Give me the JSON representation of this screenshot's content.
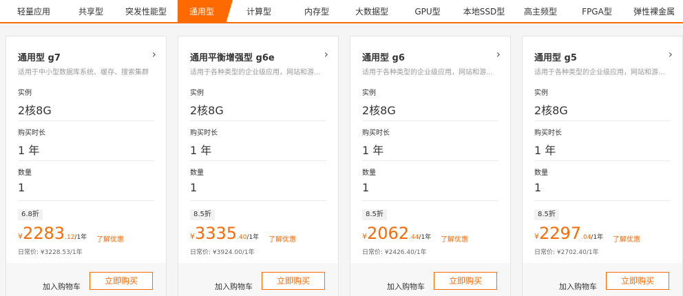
{
  "tabs": [
    {
      "label": "轻量应用",
      "active": false
    },
    {
      "label": "共享型",
      "active": false
    },
    {
      "label": "突发性能型",
      "active": false
    },
    {
      "label": "通用型",
      "active": true
    },
    {
      "label": "计算型",
      "active": false
    },
    {
      "label": "内存型",
      "active": false
    },
    {
      "label": "大数据型",
      "active": false
    },
    {
      "label": "GPU型",
      "active": false
    },
    {
      "label": "本地SSD型",
      "active": false
    },
    {
      "label": "高主频型",
      "active": false
    },
    {
      "label": "FPGA型",
      "active": false
    },
    {
      "label": "弹性裸金属",
      "active": false
    }
  ],
  "cards": [
    {
      "title": "通用型 g7",
      "desc": "适用于中小型数据库系统、缓存、搜索集群",
      "instance_label": "实例",
      "instance_value": "2核8G",
      "duration_label": "购买时长",
      "duration_value": "1 年",
      "qty_label": "数量",
      "qty_value": "1",
      "discount": "6.8折",
      "price_yen": "¥",
      "price_int": "2283",
      "price_dec": ".12",
      "price_unit": "/1年",
      "promo": "了解优惠",
      "regular": "日常价: ¥3228.53/1年",
      "cart": "加入购物车",
      "buy": "立即购买"
    },
    {
      "title": "通用平衡增强型 g6e",
      "desc": "适用于各种类型的企业级应用，网站和游...",
      "instance_label": "实例",
      "instance_value": "2核8G",
      "duration_label": "购买时长",
      "duration_value": "1 年",
      "qty_label": "数量",
      "qty_value": "1",
      "discount": "8.5折",
      "price_yen": "¥",
      "price_int": "3335",
      "price_dec": ".40",
      "price_unit": "/1年",
      "promo": "了解优惠",
      "regular": "日常价: ¥3924.00/1年",
      "cart": "加入购物车",
      "buy": "立即购买"
    },
    {
      "title": "通用型 g6",
      "desc": "适用于各种类型的企业级应用，网站和游...",
      "instance_label": "实例",
      "instance_value": "2核8G",
      "duration_label": "购买时长",
      "duration_value": "1 年",
      "qty_label": "数量",
      "qty_value": "1",
      "discount": "8.5折",
      "price_yen": "¥",
      "price_int": "2062",
      "price_dec": ".44",
      "price_unit": "/1年",
      "promo": "了解优惠",
      "regular": "日常价: ¥2426.40/1年",
      "cart": "加入购物车",
      "buy": "立即购买"
    },
    {
      "title": "通用型 g5",
      "desc": "适用于各种类型的企业级应用，网站和游...",
      "instance_label": "实例",
      "instance_value": "2核8G",
      "duration_label": "购买时长",
      "duration_value": "1 年",
      "qty_label": "数量",
      "qty_value": "1",
      "discount": "8.5折",
      "price_yen": "¥",
      "price_int": "2297",
      "price_dec": ".04",
      "price_unit": "/1年",
      "promo": "了解优惠",
      "regular": "日常价: ¥2702.40/1年",
      "cart": "加入购物车",
      "buy": "立即购买"
    }
  ],
  "colors": {
    "accent": "#ff6a00",
    "background": "#f5f5f5",
    "card": "#ffffff"
  },
  "icons": {
    "card_arrow": "chevron-right-icon"
  }
}
